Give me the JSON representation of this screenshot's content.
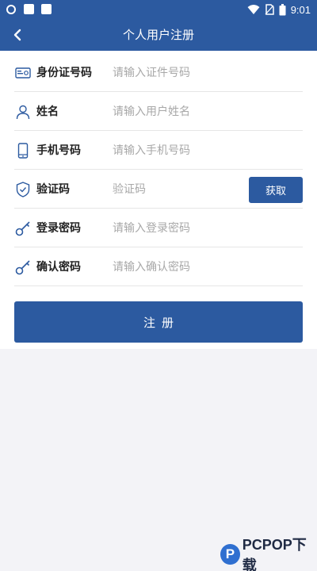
{
  "status_bar": {
    "time": "9:01",
    "icons": [
      "circle-icon",
      "app-square-icon",
      "app-square-icon",
      "wifi-icon",
      "no-sim-icon",
      "battery-icon"
    ]
  },
  "header": {
    "title": "个人用户注册",
    "back_icon": "chevron-left-icon"
  },
  "form": {
    "fields": [
      {
        "label": "身份证号码",
        "placeholder": "请输入证件号码",
        "value": "",
        "icon": "id-card-icon"
      },
      {
        "label": "姓名",
        "placeholder": "请输入用户姓名",
        "value": "",
        "icon": "person-icon"
      },
      {
        "label": "手机号码",
        "placeholder": "请输入手机号码",
        "value": "",
        "icon": "phone-icon"
      },
      {
        "label": "验证码",
        "placeholder": "验证码",
        "value": "",
        "icon": "shield-check-icon"
      },
      {
        "label": "登录密码",
        "placeholder": "请输入登录密码",
        "value": "",
        "icon": "key-icon"
      },
      {
        "label": "确认密码",
        "placeholder": "请输入确认密码",
        "value": "",
        "icon": "key-icon"
      }
    ],
    "get_code_label": "获取",
    "submit_label": "注册"
  },
  "watermark": {
    "logo_letter": "P",
    "text": "PCPOP下载"
  },
  "colors": {
    "primary": "#2c5aa0",
    "background": "#f3f3f7",
    "placeholder": "#a8a8a8"
  }
}
